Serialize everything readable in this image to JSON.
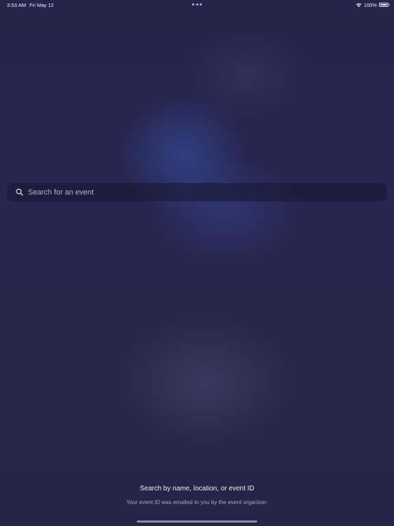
{
  "status_bar": {
    "time": "3:53 AM",
    "date": "Fri May 12",
    "battery": "100%",
    "wifi_icon": "wifi-icon",
    "battery_icon": "battery-full-icon",
    "multitask_icon": "ellipsis-icon"
  },
  "search": {
    "placeholder": "Search for an event",
    "value": "",
    "icon": "search-icon"
  },
  "hint": {
    "title": "Search by name, location, or event ID",
    "subtitle": "Your event ID was emailed to you by the event organizer."
  },
  "colors": {
    "background": "#262548",
    "search_field": "#1f1e3c",
    "text_primary": "#ffffff",
    "text_secondary": "#a9a8bf"
  }
}
